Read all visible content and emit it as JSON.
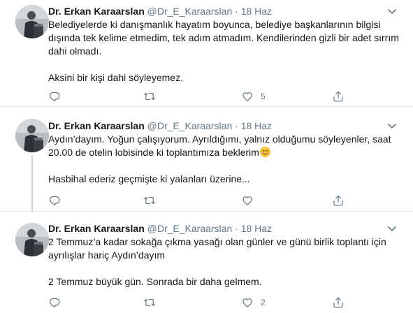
{
  "tweets": [
    {
      "author_name": "Dr. Erkan Karaarslan",
      "handle": "@Dr_E_Karaarslan",
      "separator": "·",
      "date": "18 Haz",
      "paragraphs": [
        "Belediyelerde ki danışmanlık hayatım boyunca, belediye başkanlarının bilgisi dışında tek kelime etmedim, tek adım atmadım. Kendilerinden gizli bir adet sırrım dahi olmadı.",
        "Aksini bir kişi dahi söyleyemez."
      ],
      "reply_count": "",
      "retweet_count": "",
      "like_count": "5"
    },
    {
      "author_name": "Dr. Erkan Karaarslan",
      "handle": "@Dr_E_Karaarslan",
      "separator": "·",
      "date": "18 Haz",
      "paragraphs": [
        "Aydın’dayım. Yoğun çalışıyorum. Ayrıldığımı, yalnız olduğumu söyleyenler, saat 20.00 de otelin lobisinde ki toplantımıza beklerim",
        "Hasbihal ederiz geçmişte ki yalanları üzerine..."
      ],
      "emoji": "smiling-face-emoji",
      "reply_count": "",
      "retweet_count": "",
      "like_count": ""
    },
    {
      "author_name": "Dr. Erkan Karaarslan",
      "handle": "@Dr_E_Karaarslan",
      "separator": "·",
      "date": "18 Haz",
      "paragraphs": [
        "2 Temmuz’a kadar sokağa çıkma yasağı olan günler ve günü birlik toplantı için ayrılışlar hariç Aydın’dayım",
        "2 Temmuz büyük gün. Sonrada bir daha gelmem."
      ],
      "reply_count": "",
      "retweet_count": "",
      "like_count": "2"
    }
  ],
  "icons": {
    "reply": "reply-icon",
    "retweet": "retweet-icon",
    "like": "like-icon",
    "share": "share-icon",
    "menu": "chevron-down-icon"
  },
  "colors": {
    "text": "#14171a",
    "secondary": "#657786",
    "divider": "#e6ecf0",
    "thread_line": "#ccd6dd"
  }
}
